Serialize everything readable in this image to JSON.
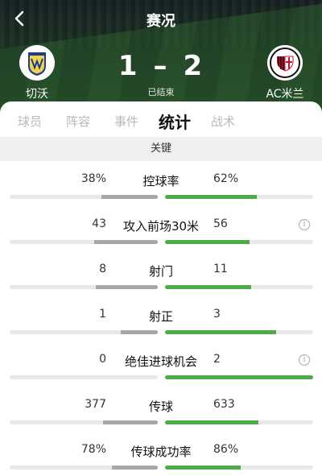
{
  "header": {
    "title": "赛况",
    "home": {
      "name": "切沃",
      "score": "1"
    },
    "away": {
      "name": "AC米兰",
      "score": "2"
    },
    "dash": "–",
    "status": "已结束"
  },
  "tabs": [
    {
      "label": "球员",
      "active": false
    },
    {
      "label": "阵容",
      "active": false
    },
    {
      "label": "事件",
      "active": false
    },
    {
      "label": "统计",
      "active": true
    },
    {
      "label": "战术",
      "active": false
    }
  ],
  "section": {
    "title": "关键"
  },
  "stats": [
    {
      "label": "控球率",
      "home": "38%",
      "away": "62%",
      "home_frac": 0.38,
      "away_frac": 0.62,
      "info": false
    },
    {
      "label": "攻入前场30米",
      "home": "43",
      "away": "56",
      "home_frac": 0.43,
      "away_frac": 0.57,
      "info": true
    },
    {
      "label": "射门",
      "home": "8",
      "away": "11",
      "home_frac": 0.42,
      "away_frac": 0.58,
      "info": false
    },
    {
      "label": "射正",
      "home": "1",
      "away": "3",
      "home_frac": 0.25,
      "away_frac": 0.75,
      "info": false
    },
    {
      "label": "绝佳进球机会",
      "home": "0",
      "away": "2",
      "home_frac": 0.0,
      "away_frac": 1.0,
      "info": true
    },
    {
      "label": "传球",
      "home": "377",
      "away": "633",
      "home_frac": 0.37,
      "away_frac": 0.63,
      "info": false
    },
    {
      "label": "传球成功率",
      "home": "78%",
      "away": "86%",
      "home_frac": 0.31,
      "away_frac": 0.51,
      "info": false
    }
  ],
  "colors": {
    "home_bar": "#a4a7ab",
    "away_bar": "#4eab48",
    "track": "#e8e8e8"
  },
  "icons": {
    "back": "chevron-left-icon",
    "info": "info-icon"
  }
}
